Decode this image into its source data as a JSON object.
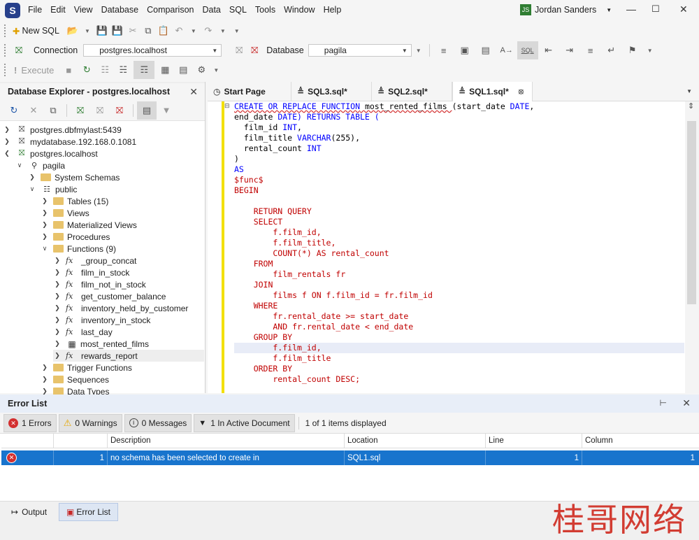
{
  "app": {
    "logo": "S"
  },
  "menu": [
    "File",
    "Edit",
    "View",
    "Database",
    "Comparison",
    "Data",
    "SQL",
    "Tools",
    "Window",
    "Help"
  ],
  "user": {
    "initials": "JS",
    "name": "Jordan Sanders"
  },
  "toolbar1": {
    "new_sql": "New SQL"
  },
  "toolbar2": {
    "connection_label": "Connection",
    "connection_value": "postgres.localhost",
    "database_label": "Database",
    "database_value": "pagila"
  },
  "toolbar3": {
    "execute": "Execute"
  },
  "explorer": {
    "title": "Database Explorer - postgres.localhost",
    "nodes": [
      {
        "label": "postgres.dbfmylast:5439"
      },
      {
        "label": "mydatabase.192.168.0.1081"
      },
      {
        "label": "postgres.localhost"
      },
      {
        "label": "pagila"
      },
      {
        "label": "System Schemas"
      },
      {
        "label": "public"
      },
      {
        "label": "Tables (15)"
      },
      {
        "label": "Views"
      },
      {
        "label": "Materialized Views"
      },
      {
        "label": "Procedures"
      },
      {
        "label": "Functions (9)"
      },
      {
        "label": "_group_concat"
      },
      {
        "label": "film_in_stock"
      },
      {
        "label": "film_not_in_stock"
      },
      {
        "label": "get_customer_balance"
      },
      {
        "label": "inventory_held_by_customer"
      },
      {
        "label": "inventory_in_stock"
      },
      {
        "label": "last_day"
      },
      {
        "label": "most_rented_films"
      },
      {
        "label": "rewards_report"
      },
      {
        "label": "Trigger Functions"
      },
      {
        "label": "Sequences"
      },
      {
        "label": "Data Types"
      }
    ],
    "fx_glyph": "fx"
  },
  "tabs": [
    {
      "label": "Start Page"
    },
    {
      "label": "SQL3.sql*"
    },
    {
      "label": "SQL2.sql*"
    },
    {
      "label": "SQL1.sql*"
    }
  ],
  "code": {
    "l1a": "CREATE OR REPLACE FUNCTION",
    "l1b": " most_rented_films ",
    "l1c": "(start_date ",
    "l1d": "DATE",
    "l2a": "end_date ",
    "l2b": "DATE) RETURNS TABLE (",
    "l3a": "  film_id ",
    "l3b": "INT",
    "l4a": "  film_title ",
    "l4b": "VARCHAR",
    "l4c": "(255),",
    "l5a": "  rental_count ",
    "l5b": "INT",
    "l6": ")",
    "l7": "AS",
    "l8": "$func$",
    "l9": "BEGIN",
    "l10": "",
    "l11": "    RETURN QUERY",
    "l12": "    SELECT",
    "l13": "        f.film_id,",
    "l14": "        f.film_title,",
    "l15": "        COUNT(*) AS rental_count",
    "l16": "    FROM",
    "l17": "        film_rentals fr",
    "l18": "    JOIN",
    "l19": "        films f ON f.film_id = fr.film_id",
    "l20": "    WHERE",
    "l21": "        fr.rental_date >= start_date",
    "l22": "        AND fr.rental_date < end_date",
    "l23": "    GROUP BY",
    "l24": "        f.film_id,",
    "l25": "        f.film_title",
    "l26": "    ORDER BY",
    "l27": "        rental_count DESC;"
  },
  "error_list": {
    "title": "Error List",
    "errors": "1 Errors",
    "warnings": "0 Warnings",
    "messages": "0 Messages",
    "active_doc": "1 In Active Document",
    "displayed": "1 of 1 items displayed",
    "headers": {
      "description": "Description",
      "location": "Location",
      "line": "Line",
      "column": "Column"
    },
    "row": {
      "index": "1",
      "description": "no schema has been selected to create in",
      "location": "SQL1.sql",
      "line": "1",
      "column": "1"
    }
  },
  "bottom": {
    "output": "Output",
    "error_list": "Error List"
  },
  "watermark": "桂哥网络",
  "colors": {
    "accent": "#1874cd",
    "error": "#d32f2f",
    "keyword": "#0000ff",
    "body_keyword": "#c00000",
    "gutter": "#f3e000"
  }
}
